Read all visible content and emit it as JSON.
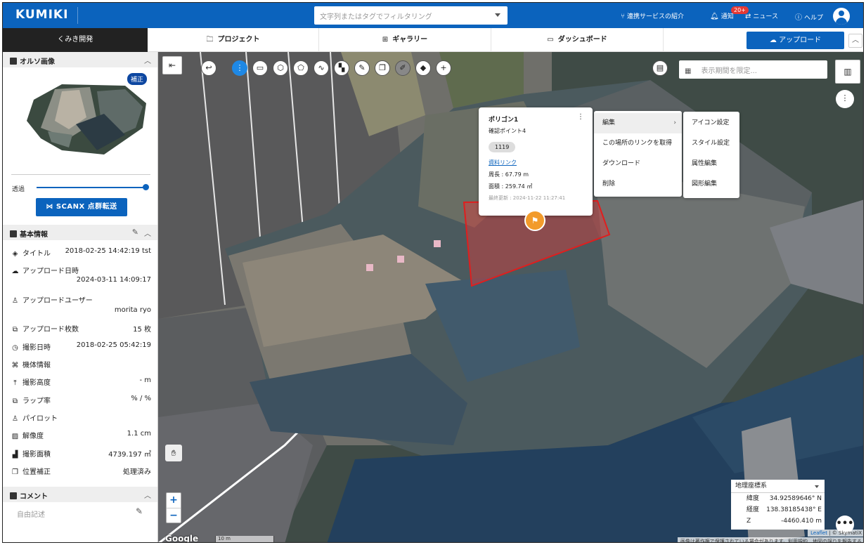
{
  "header": {
    "logo": "KUMIKI",
    "search_placeholder": "文字列またはタグでフィルタリング",
    "links": [
      {
        "label": "連携サービスの紹介",
        "icon": "share-icon"
      },
      {
        "label": "通知",
        "icon": "bell-icon"
      },
      {
        "label": "ニュース",
        "icon": "news-icon"
      },
      {
        "label": "ヘルプ",
        "icon": "help-icon"
      }
    ],
    "notification_badge": "20+"
  },
  "nav": {
    "project_name": "くみき開発",
    "tabs": [
      {
        "label": "プロジェクト",
        "icon": "folder-icon"
      },
      {
        "label": "ギャラリー",
        "icon": "grid-icon"
      },
      {
        "label": "ダッシュボード",
        "icon": "monitor-icon"
      }
    ],
    "upload_label": "アップロード"
  },
  "sidebar": {
    "ortho": {
      "title": "オルソ画像",
      "badge": "補正",
      "transparency_label": "透過",
      "transparency_value": 1.0,
      "scanx_label": "SCANX 点群転送"
    },
    "basic": {
      "title": "基本情報",
      "rows": [
        {
          "label": "タイトル",
          "value": "2018-02-25 14:42:19 tst"
        },
        {
          "label": "アップロード日時",
          "value": "2024-03-11 14:09:17"
        },
        {
          "label": "アップロードユーザー",
          "value": "morita ryo"
        },
        {
          "label": "アップロード枚数",
          "value": "15 枚"
        },
        {
          "label": "撮影日時",
          "value": "2018-02-25 05:42:19"
        },
        {
          "label": "機体情報",
          "value": ""
        },
        {
          "label": "撮影高度",
          "value": "- m"
        },
        {
          "label": "ラップ率",
          "value": "% / %"
        },
        {
          "label": "パイロット",
          "value": ""
        },
        {
          "label": "解像度",
          "value": "1.1 cm"
        },
        {
          "label": "撮影面積",
          "value": "4739.197 ㎡"
        },
        {
          "label": "位置補正",
          "value": "処理済み"
        }
      ]
    },
    "comment": {
      "title": "コメント",
      "placeholder": "自由記述"
    }
  },
  "map": {
    "date_filter_placeholder": "表示期間を限定...",
    "popup": {
      "title": "ポリゴン1",
      "subtitle": "確認ポイント4",
      "chip": "1119",
      "link": "資料リンク",
      "perimeter": "周長 : 67.79 m",
      "area": "面積 : 259.74 ㎡",
      "updated": "最終更新 : 2024-11-22 11:27:41"
    },
    "menu": [
      "編集",
      "この場所のリンクを取得",
      "ダウンロード",
      "削除"
    ],
    "submenu": [
      "アイコン設定",
      "スタイル設定",
      "属性編集",
      "図形編集"
    ],
    "coords": {
      "system": "地理座標系",
      "lat_label": "緯度",
      "lat": "34.92589646° N",
      "lon_label": "経度",
      "lon": "138.38185438° E",
      "z_label": "Z",
      "z": "-4460.410 m"
    },
    "scale_label": "10 m",
    "google_label": "Google",
    "attribution_leaflet": "Leaflet",
    "attribution_rest": " | © SkymatiX",
    "attribution_line2": "画像は著作権で保護されている場合があります。利用規約　地図の誤りを報告する"
  }
}
